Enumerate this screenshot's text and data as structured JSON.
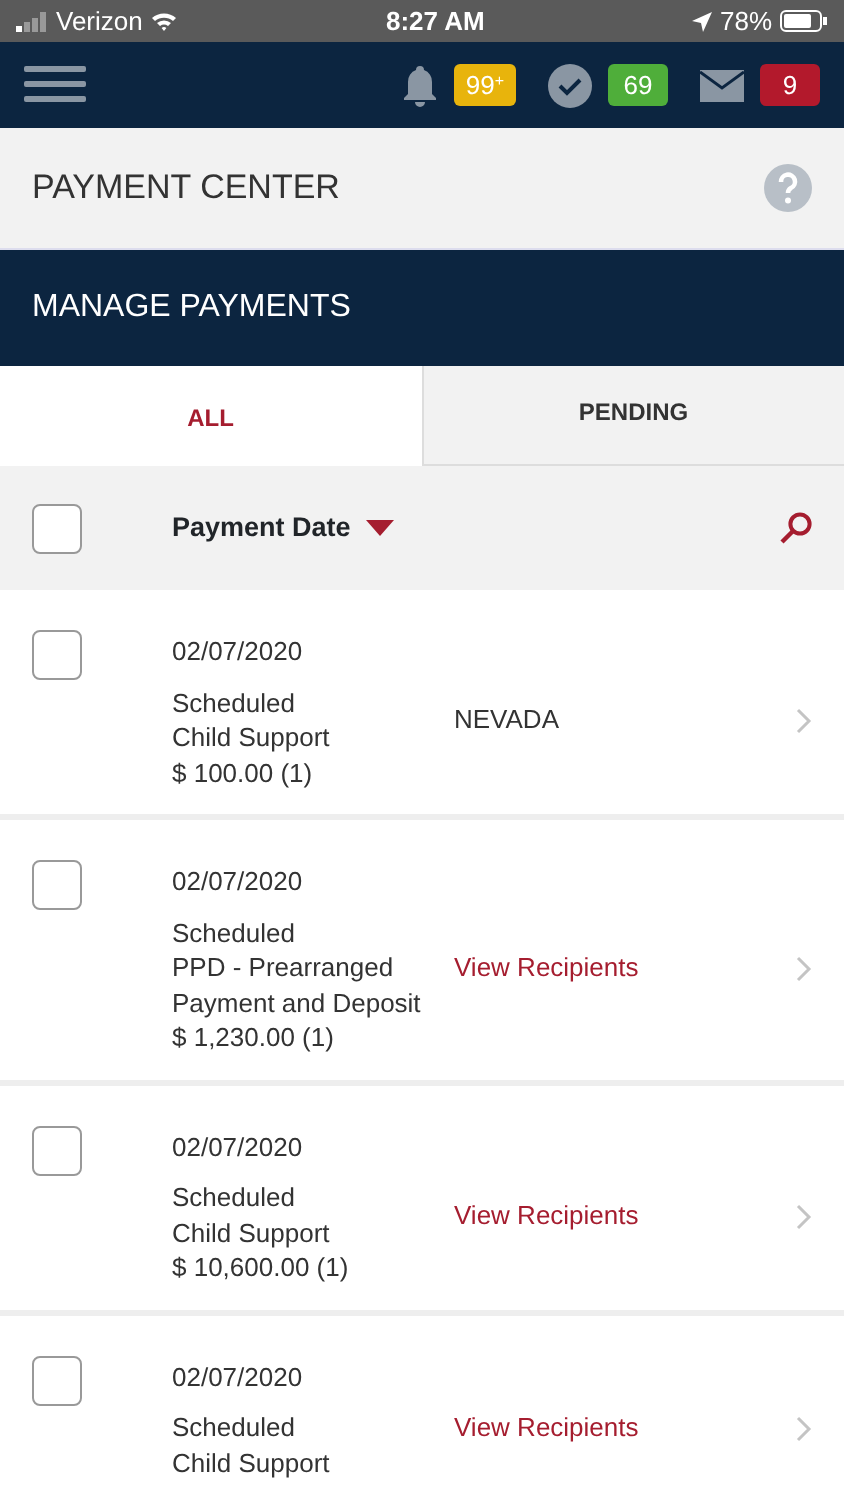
{
  "status_bar": {
    "carrier": "Verizon",
    "time": "8:27 AM",
    "battery": "78%"
  },
  "nav": {
    "badges": [
      {
        "kind": "bell",
        "count": "99",
        "sup": "+",
        "color": "#e8b40c"
      },
      {
        "kind": "check",
        "count": "69",
        "color": "#4fae3a"
      },
      {
        "kind": "mail",
        "count": "9",
        "color": "#b3192c"
      }
    ]
  },
  "page_title": "PAYMENT CENTER",
  "section_title": "MANAGE PAYMENTS",
  "tabs": [
    {
      "label": "ALL",
      "selected": true
    },
    {
      "label": "PENDING",
      "selected": false
    }
  ],
  "sort_header": {
    "label": "Payment Date",
    "checked": false
  },
  "payments": [
    {
      "checked": false,
      "date": "02/07/2020",
      "status": "Scheduled",
      "type": "Child Support",
      "amount": "$ 100.00 (1)",
      "recipient": {
        "kind": "text",
        "text": "NEVADA"
      }
    },
    {
      "checked": false,
      "date": "02/07/2020",
      "status": "Scheduled",
      "type": "PPD - Prearranged Payment and Deposit",
      "amount": "$ 1,230.00 (1)",
      "recipient": {
        "kind": "link",
        "text": "View Recipients"
      }
    },
    {
      "checked": false,
      "date": "02/07/2020",
      "status": "Scheduled",
      "type": "Child Support",
      "amount": "$ 10,600.00 (1)",
      "recipient": {
        "kind": "link",
        "text": "View Recipients"
      }
    },
    {
      "checked": false,
      "date": "02/07/2020",
      "status": "Scheduled",
      "type": "Child Support",
      "recipient": {
        "kind": "link",
        "text": "View Recipients"
      }
    }
  ]
}
